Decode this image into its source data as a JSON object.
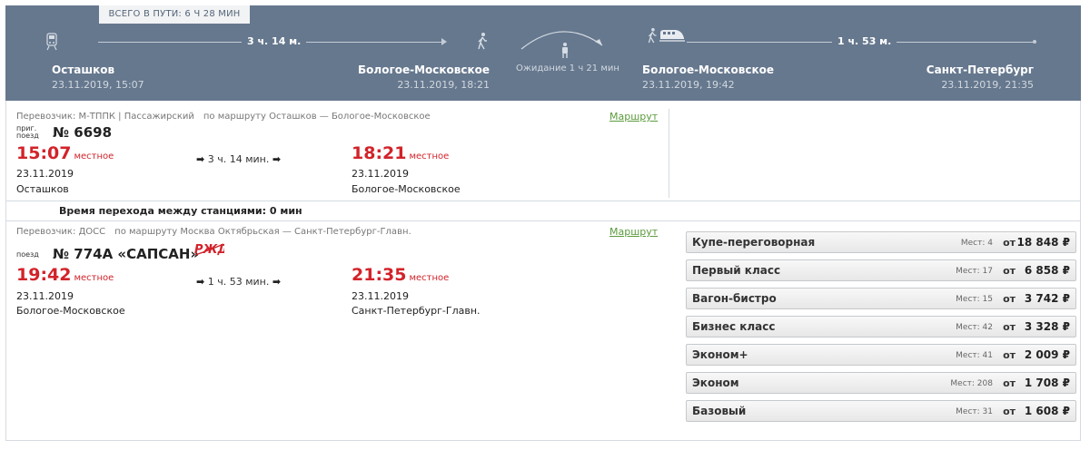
{
  "journey": {
    "total": "ВСЕГО В ПУТИ: 6 Ч 28 МИН",
    "seg1_duration": "3 ч. 14 м.",
    "seg2_duration": "1 ч. 53 м.",
    "wait": "Ожидание 1 ч 21 мин",
    "stations": [
      {
        "name": "Осташков",
        "datetime": "23.11.2019, 15:07"
      },
      {
        "name": "Бологое-Московское",
        "datetime": "23.11.2019, 18:21"
      },
      {
        "name": "Бологое-Московское",
        "datetime": "23.11.2019, 19:42"
      },
      {
        "name": "Санкт-Петербург",
        "datetime": "23.11.2019, 21:35"
      }
    ]
  },
  "train1": {
    "carrier": "Перевозчик: М-ТППК | Пассажирский",
    "route": "по маршруту Осташков — Бологое-Московское",
    "route_link": "Маршрут",
    "type_line1": "приг.",
    "type_line2": "поезд",
    "number": "№ 6698",
    "dep_time": "15:07",
    "arr_time": "18:21",
    "local": "местное",
    "duration": "3 ч. 14 мин.",
    "dep_date": "23.11.2019",
    "arr_date": "23.11.2019",
    "dep_station": "Осташков",
    "arr_station": "Бологое-Московское"
  },
  "transfer": "Время перехода между станциями: 0 мин",
  "train2": {
    "carrier": "Перевозчик: ДОСС",
    "route": "по маршруту Москва Октябрьская — Санкт-Петербург-Главн.",
    "route_link": "Маршрут",
    "type_line1": "поезд",
    "number": "№ 774А «САПСАН»",
    "dep_time": "19:42",
    "arr_time": "21:35",
    "local": "местное",
    "duration": "1 ч. 53 мин.",
    "dep_date": "23.11.2019",
    "arr_date": "23.11.2019",
    "dep_station": "Бологое-Московское",
    "arr_station": "Санкт-Петербург-Главн."
  },
  "fares": [
    {
      "name": "Купе-переговорная",
      "seats": "Мест: 4",
      "from": "от",
      "price": "18 848 ₽"
    },
    {
      "name": "Первый класс",
      "seats": "Мест: 17",
      "from": "от",
      "price": "6 858 ₽"
    },
    {
      "name": "Вагон-бистро",
      "seats": "Мест: 15",
      "from": "от",
      "price": "3 742 ₽"
    },
    {
      "name": "Бизнес класс",
      "seats": "Мест: 42",
      "from": "от",
      "price": "3 328 ₽"
    },
    {
      "name": "Эконом+",
      "seats": "Мест: 41",
      "from": "от",
      "price": "2 009 ₽"
    },
    {
      "name": "Эконом",
      "seats": "Мест: 208",
      "from": "от",
      "price": "1 708 ₽"
    },
    {
      "name": "Базовый",
      "seats": "Мест: 31",
      "from": "от",
      "price": "1 608 ₽"
    }
  ],
  "colors": {
    "header_bg": "#66788e",
    "time_red": "#d2232a",
    "link_green": "#5b9a3c"
  },
  "icons": [
    "commuter-train-icon",
    "walking-person-icon",
    "waiting-person-icon",
    "high-speed-train-icon",
    "rzd-logo-icon",
    "arrow-right-icon"
  ]
}
